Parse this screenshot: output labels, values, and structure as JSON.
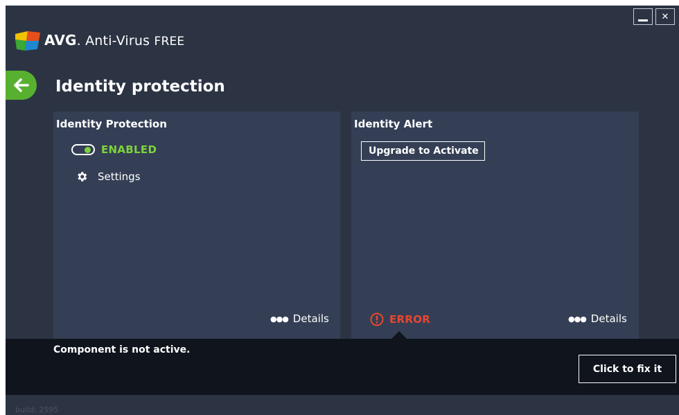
{
  "window": {
    "app_brand": "AVG",
    "app_name": "Anti-Virus",
    "app_edition": "FREE"
  },
  "page": {
    "title": "Identity protection"
  },
  "identity_protection": {
    "title": "Identity Protection",
    "status": "ENABLED",
    "settings_label": "Settings",
    "details_label": "Details"
  },
  "identity_alert": {
    "title": "Identity Alert",
    "upgrade_label": "Upgrade to Activate",
    "status": "ERROR",
    "details_label": "Details"
  },
  "status_bar": {
    "message": "Component is not active.",
    "fix_label": "Click to fix it"
  },
  "footer": {
    "build": "build: 2595"
  },
  "colors": {
    "background": "#2c3444",
    "panel": "#343f55",
    "enabled": "#7fd33d",
    "error": "#e8462e",
    "back_button": "#58b030"
  }
}
